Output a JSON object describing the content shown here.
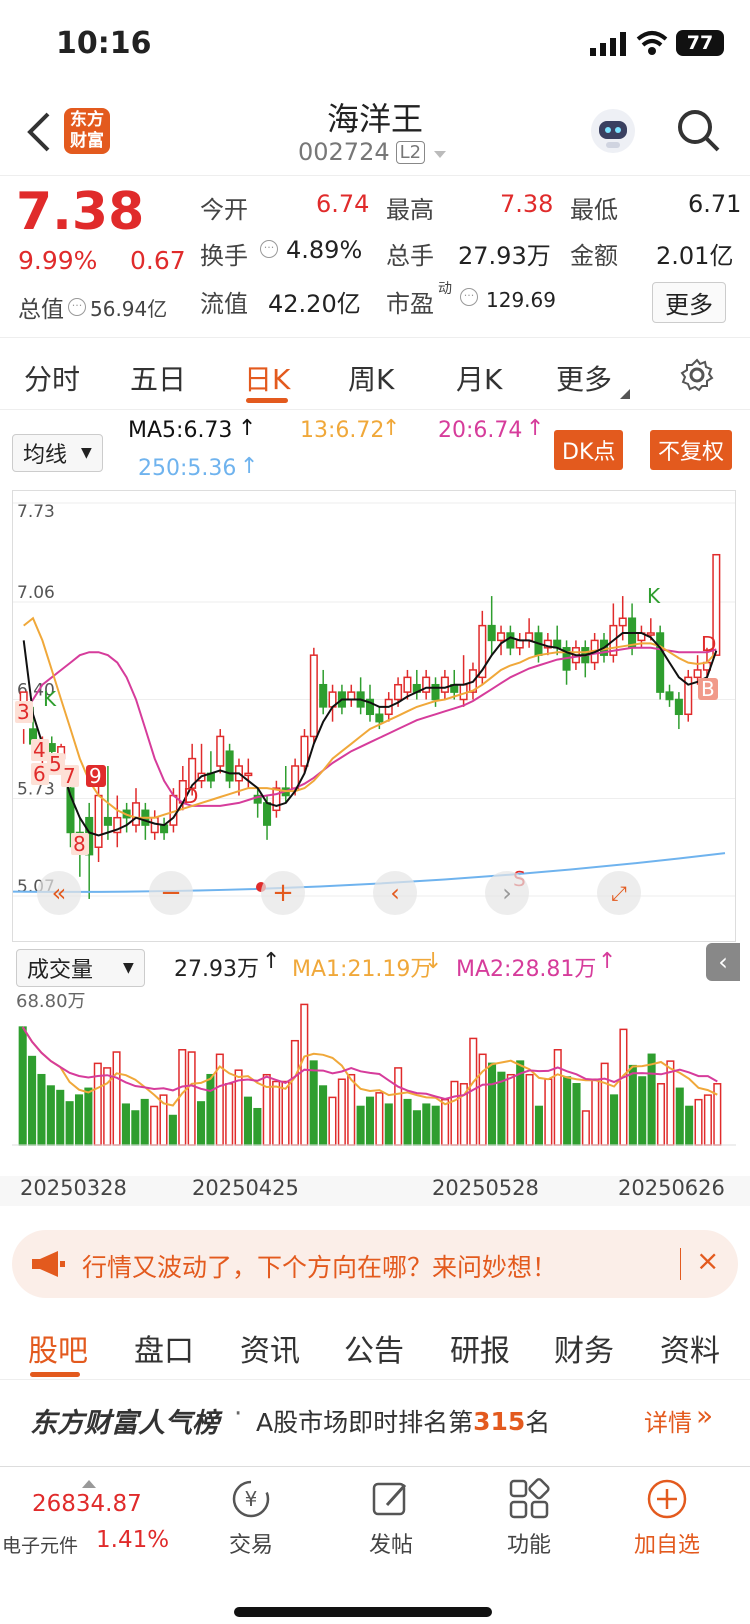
{
  "status": {
    "time": "10:16",
    "battery": "77"
  },
  "nav": {
    "stock_name": "海洋王",
    "stock_code": "002724",
    "level": "L2",
    "brand_line1": "东方",
    "brand_line2": "财富"
  },
  "quote": {
    "price": "7.38",
    "pct": "9.99%",
    "change": "0.67",
    "open_label": "今开",
    "open": "6.74",
    "high_label": "最高",
    "high": "7.38",
    "low_label": "最低",
    "low": "6.71",
    "turnover_label": "换手",
    "turnover": "4.89%",
    "volume_label": "总手",
    "volume": "27.93万",
    "amount_label": "金额",
    "amount": "2.01亿",
    "mcap_label": "总值",
    "mcap": "56.94亿",
    "float_label": "流值",
    "float": "42.20亿",
    "pe_label": "市盈",
    "pe_sup": "动",
    "pe": "129.69",
    "more": "更多"
  },
  "tabs": [
    "分时",
    "五日",
    "日K",
    "周K",
    "月K",
    "更多"
  ],
  "ma": {
    "select": "均线",
    "ma5": "MA5:6.73",
    "ma13": "13:6.72",
    "ma20": "20:6.74",
    "ma250": "250:5.36",
    "dk_button": "DK点",
    "adjust_button": "不复权"
  },
  "chart_data": {
    "type": "candlestick",
    "y_ticks": [
      "7.73",
      "7.06",
      "6.40",
      "5.73",
      "5.07"
    ],
    "ylim": [
      5.07,
      7.73
    ],
    "markers": [
      "K",
      "3",
      "4",
      "5",
      "6",
      "7",
      "8",
      "9",
      "D",
      "K",
      "D",
      "B",
      "S"
    ],
    "candles": [
      [
        6.35,
        6.45,
        6.2,
        6.1
      ],
      [
        6.2,
        6.1,
        6.35,
        6.0
      ],
      [
        6.05,
        6.1,
        6.15,
        5.95
      ],
      [
        6.1,
        6.05,
        6.15,
        6.0
      ],
      [
        6.0,
        6.08,
        6.1,
        5.95
      ],
      [
        5.8,
        5.5,
        5.85,
        5.4
      ],
      [
        5.5,
        5.45,
        5.6,
        5.2
      ],
      [
        5.6,
        5.35,
        5.7,
        5.05
      ],
      [
        5.4,
        5.75,
        5.85,
        5.3
      ],
      [
        5.6,
        5.55,
        5.95,
        5.45
      ],
      [
        5.5,
        5.6,
        5.75,
        5.4
      ],
      [
        5.65,
        5.6,
        5.7,
        5.5
      ],
      [
        5.55,
        5.7,
        5.8,
        5.5
      ],
      [
        5.65,
        5.55,
        5.7,
        5.45
      ],
      [
        5.5,
        5.6,
        5.65,
        5.45
      ],
      [
        5.55,
        5.5,
        5.6,
        5.45
      ],
      [
        5.55,
        5.75,
        5.8,
        5.5
      ],
      [
        5.7,
        5.85,
        5.95,
        5.65
      ],
      [
        5.8,
        6.0,
        6.1,
        5.75
      ],
      [
        5.85,
        5.9,
        6.1,
        5.8
      ],
      [
        5.9,
        5.85,
        6.05,
        5.8
      ],
      [
        5.95,
        6.15,
        6.2,
        5.9
      ],
      [
        6.05,
        5.85,
        6.1,
        5.8
      ],
      [
        5.85,
        5.95,
        6.0,
        5.75
      ],
      [
        5.9,
        5.9,
        6.0,
        5.8
      ],
      [
        5.75,
        5.7,
        5.8,
        5.6
      ],
      [
        5.7,
        5.55,
        5.75,
        5.45
      ],
      [
        5.65,
        5.8,
        5.85,
        5.6
      ],
      [
        5.8,
        5.75,
        5.95,
        5.7
      ],
      [
        5.8,
        5.95,
        6.0,
        5.75
      ],
      [
        5.95,
        6.15,
        6.2,
        5.9
      ],
      [
        6.15,
        6.7,
        6.75,
        6.1
      ],
      [
        6.5,
        6.35,
        6.6,
        6.3
      ],
      [
        6.35,
        6.45,
        6.5,
        6.25
      ],
      [
        6.45,
        6.35,
        6.5,
        6.3
      ],
      [
        6.4,
        6.45,
        6.5,
        6.35
      ],
      [
        6.45,
        6.35,
        6.55,
        6.3
      ],
      [
        6.4,
        6.3,
        6.5,
        6.25
      ],
      [
        6.3,
        6.25,
        6.35,
        6.2
      ],
      [
        6.3,
        6.4,
        6.45,
        6.25
      ],
      [
        6.4,
        6.5,
        6.55,
        6.35
      ],
      [
        6.45,
        6.55,
        6.6,
        6.4
      ],
      [
        6.5,
        6.45,
        6.6,
        6.4
      ],
      [
        6.45,
        6.55,
        6.6,
        6.4
      ],
      [
        6.5,
        6.4,
        6.55,
        6.35
      ],
      [
        6.45,
        6.55,
        6.6,
        6.4
      ],
      [
        6.5,
        6.45,
        6.6,
        6.4
      ],
      [
        6.4,
        6.5,
        6.7,
        6.35
      ],
      [
        6.45,
        6.6,
        6.65,
        6.4
      ],
      [
        6.55,
        6.9,
        7.0,
        6.5
      ],
      [
        6.9,
        6.8,
        7.1,
        6.7
      ],
      [
        6.8,
        6.85,
        6.9,
        6.7
      ],
      [
        6.85,
        6.75,
        6.9,
        6.7
      ],
      [
        6.75,
        6.8,
        6.85,
        6.7
      ],
      [
        6.8,
        6.85,
        6.95,
        6.75
      ],
      [
        6.85,
        6.7,
        6.9,
        6.65
      ],
      [
        6.75,
        6.8,
        6.85,
        6.7
      ],
      [
        6.8,
        6.75,
        6.9,
        6.7
      ],
      [
        6.75,
        6.6,
        6.8,
        6.5
      ],
      [
        6.65,
        6.75,
        6.8,
        6.6
      ],
      [
        6.75,
        6.65,
        6.8,
        6.55
      ],
      [
        6.65,
        6.8,
        6.85,
        6.6
      ],
      [
        6.8,
        6.7,
        6.85,
        6.65
      ],
      [
        6.7,
        6.9,
        7.05,
        6.65
      ],
      [
        6.9,
        6.95,
        7.1,
        6.8
      ],
      [
        6.95,
        6.75,
        7.05,
        6.7
      ],
      [
        6.8,
        6.85,
        6.9,
        6.75
      ],
      [
        6.85,
        6.85,
        6.95,
        6.8
      ],
      [
        6.85,
        6.45,
        6.9,
        6.4
      ],
      [
        6.45,
        6.4,
        6.5,
        6.35
      ],
      [
        6.4,
        6.3,
        6.45,
        6.2
      ],
      [
        6.3,
        6.55,
        6.6,
        6.25
      ],
      [
        6.55,
        6.6,
        6.7,
        6.5
      ],
      [
        6.6,
        6.65,
        6.75,
        6.55
      ],
      [
        6.7,
        7.38,
        7.38,
        6.71
      ]
    ],
    "ma5": [
      6.8,
      6.3,
      6.1,
      6.0,
      5.95,
      5.75,
      5.6,
      5.5,
      5.48,
      5.5,
      5.52,
      5.55,
      5.6,
      5.58,
      5.56,
      5.55,
      5.6,
      5.7,
      5.82,
      5.88,
      5.9,
      5.92,
      5.9,
      5.9,
      5.85,
      5.8,
      5.7,
      5.68,
      5.7,
      5.78,
      5.9,
      6.1,
      6.25,
      6.35,
      6.4,
      6.4,
      6.4,
      6.38,
      6.35,
      6.35,
      6.38,
      6.42,
      6.45,
      6.48,
      6.48,
      6.48,
      6.5,
      6.5,
      6.52,
      6.6,
      6.7,
      6.78,
      6.82,
      6.8,
      6.8,
      6.78,
      6.76,
      6.75,
      6.72,
      6.7,
      6.7,
      6.72,
      6.75,
      6.8,
      6.85,
      6.85,
      6.85,
      6.82,
      6.75,
      6.65,
      6.55,
      6.5,
      6.52,
      6.55,
      6.73
    ],
    "ma13": [
      6.9,
      6.95,
      6.8,
      6.6,
      6.4,
      6.2,
      6.0,
      5.85,
      5.75,
      5.7,
      5.65,
      5.62,
      5.6,
      5.6,
      5.6,
      5.62,
      5.64,
      5.66,
      5.68,
      5.7,
      5.72,
      5.74,
      5.76,
      5.78,
      5.8,
      5.8,
      5.8,
      5.79,
      5.78,
      5.78,
      5.8,
      5.85,
      5.92,
      6.0,
      6.05,
      6.1,
      6.15,
      6.2,
      6.23,
      6.26,
      6.29,
      6.32,
      6.35,
      6.37,
      6.39,
      6.4,
      6.42,
      6.44,
      6.46,
      6.5,
      6.55,
      6.6,
      6.63,
      6.65,
      6.68,
      6.7,
      6.71,
      6.72,
      6.72,
      6.72,
      6.72,
      6.73,
      6.74,
      6.75,
      6.76,
      6.77,
      6.78,
      6.78,
      6.76,
      6.72,
      6.68,
      6.65,
      6.64,
      6.65,
      6.72
    ],
    "ma20": [
      6.3,
      6.4,
      6.5,
      6.55,
      6.6,
      6.65,
      6.7,
      6.72,
      6.72,
      6.7,
      6.65,
      6.55,
      6.4,
      6.2,
      6.0,
      5.85,
      5.75,
      5.7,
      5.68,
      5.68,
      5.68,
      5.68,
      5.69,
      5.7,
      5.72,
      5.74,
      5.75,
      5.76,
      5.78,
      5.8,
      5.83,
      5.87,
      5.92,
      5.97,
      6.01,
      6.05,
      6.08,
      6.11,
      6.14,
      6.17,
      6.2,
      6.23,
      6.26,
      6.28,
      6.3,
      6.32,
      6.34,
      6.36,
      6.39,
      6.43,
      6.47,
      6.51,
      6.55,
      6.58,
      6.61,
      6.63,
      6.65,
      6.67,
      6.68,
      6.69,
      6.7,
      6.71,
      6.72,
      6.73,
      6.74,
      6.75,
      6.75,
      6.75,
      6.74,
      6.73,
      6.72,
      6.72,
      6.72,
      6.72,
      6.74
    ],
    "ma250_range": [
      5.1,
      5.36
    ]
  },
  "volume": {
    "select": "成交量",
    "value": "27.93万",
    "ma1": "MA1:21.19万",
    "ma2": "MA2:28.81万",
    "top_label": "68.80万",
    "dates": [
      "20250328",
      "20250425",
      "20250528",
      "20250626"
    ],
    "bars": [
      52,
      39,
      31,
      26,
      24,
      19,
      22,
      25,
      36,
      34,
      41,
      18,
      15,
      20,
      17,
      22,
      13,
      42,
      41,
      19,
      31,
      40,
      27,
      33,
      21,
      16,
      31,
      28,
      28,
      46,
      62,
      37,
      26,
      21,
      29,
      31,
      17,
      21,
      23,
      18,
      34,
      20,
      15,
      18,
      17,
      20,
      28,
      27,
      47,
      40,
      36,
      32,
      31,
      37,
      31,
      17,
      29,
      42,
      30,
      27,
      15,
      29,
      36,
      22,
      51,
      35,
      30,
      40,
      27,
      37,
      25,
      17,
      20,
      22,
      27
    ],
    "bar_up": [
      0,
      0,
      0,
      0,
      0,
      0,
      0,
      0,
      1,
      1,
      1,
      0,
      0,
      0,
      1,
      1,
      0,
      1,
      1,
      0,
      0,
      1,
      1,
      1,
      0,
      0,
      1,
      1,
      1,
      1,
      1,
      0,
      0,
      1,
      1,
      1,
      0,
      0,
      1,
      0,
      1,
      0,
      0,
      0,
      0,
      1,
      1,
      1,
      1,
      1,
      0,
      0,
      1,
      0,
      1,
      0,
      1,
      1,
      0,
      0,
      1,
      1,
      1,
      0,
      1,
      0,
      0,
      0,
      1,
      1,
      0,
      0,
      1,
      1,
      1
    ]
  },
  "banner": {
    "text": "行情又波动了，下个方向在哪？来问妙想！"
  },
  "lower_tabs": [
    "股吧",
    "盘口",
    "资讯",
    "公告",
    "研报",
    "财务",
    "资料"
  ],
  "rank": {
    "brand": "东方财富人气榜",
    "text_prefix": "A股市场即时排名第",
    "rank": "315",
    "text_suffix": "名",
    "detail": "详情"
  },
  "bottom": {
    "index_value": "26834.87",
    "index_name": "电子元件",
    "index_pct": "1.41%",
    "trade": "交易",
    "post": "发帖",
    "func": "功能",
    "add": "加自选"
  },
  "colors": {
    "red": "#e02b2b",
    "green": "#2f9e2f",
    "accent": "#e35a1e",
    "ma5": "#111111",
    "ma13": "#f0a83a",
    "ma20": "#d63c9b",
    "ma250": "#6fb3ee"
  }
}
